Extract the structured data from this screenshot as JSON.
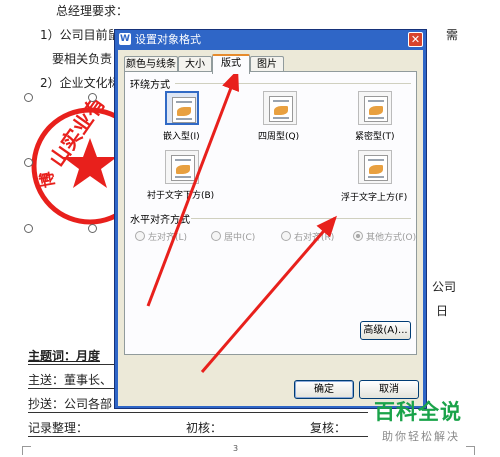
{
  "document": {
    "heading": "总经理要求：",
    "item1": "1）公司目前鼠",
    "item1_right": "需",
    "item1b": "要相关负责",
    "item2": "2）企业文化标",
    "right_text_1": "公司",
    "right_text_2": "日",
    "keywords": "主题词：月度",
    "send_to": "主送：董事长、",
    "cc": "抄送：公司各部",
    "record": "记录整理：",
    "first_check": "初核：",
    "recheck": "复核：",
    "page_number": "3",
    "stamp_text": "山实业有",
    "stamp_text_2": "博"
  },
  "dialog": {
    "title": "设置对象格式",
    "close_label": "✕",
    "tabs": [
      {
        "label": "颜色与线条",
        "active": false
      },
      {
        "label": "大小",
        "active": false
      },
      {
        "label": "版式",
        "active": true
      },
      {
        "label": "图片",
        "active": false
      }
    ],
    "wrap_section": "环绕方式",
    "wrap_options": [
      {
        "label": "嵌入型(I)",
        "icon": "inline-wrap-icon",
        "selected": true
      },
      {
        "label": "四周型(Q)",
        "icon": "square-wrap-icon",
        "selected": false
      },
      {
        "label": "紧密型(T)",
        "icon": "tight-wrap-icon",
        "selected": false
      },
      {
        "label": "衬于文字下方(B)",
        "icon": "behind-text-icon",
        "selected": false
      },
      {
        "label": "浮于文字上方(F)",
        "icon": "in-front-text-icon",
        "selected": false
      }
    ],
    "align_section": "水平对齐方式",
    "align_options": [
      {
        "label": "左对齐(L)",
        "checked": false
      },
      {
        "label": "居中(C)",
        "checked": false
      },
      {
        "label": "右对齐(R)",
        "checked": false
      },
      {
        "label": "其他方式(O)",
        "checked": true
      }
    ],
    "advanced_button": "高级(A)...",
    "ok_button": "确定",
    "cancel_button": "取消"
  },
  "watermark": {
    "title": "百科全说",
    "subtitle": "助你轻松解决"
  },
  "colors": {
    "dialog_title_bar": "#2f66c7",
    "dialog_body": "#ece9d8",
    "arrow": "#e8201c",
    "stamp": "#e8201c",
    "watermark": "#1aa34a"
  }
}
